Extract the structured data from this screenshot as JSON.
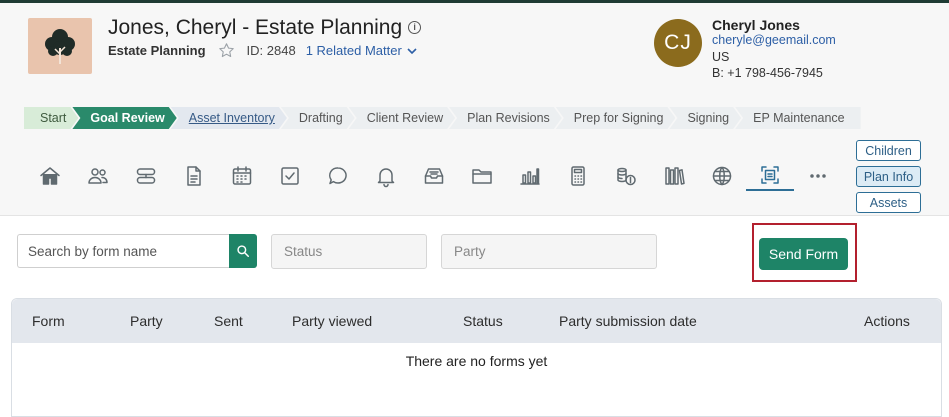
{
  "matter": {
    "title": "Jones, Cheryl - Estate Planning",
    "practice_area": "Estate Planning",
    "id_label": "ID: 2848",
    "related_matter": "1 Related Matter"
  },
  "client": {
    "initials": "CJ",
    "name": "Cheryl Jones",
    "email": "cheryle@geemail.com",
    "country": "US",
    "phone": "B: +1 798-456-7945",
    "avatar_color": "#8b6b1d"
  },
  "stages": [
    {
      "label": "Start",
      "state": "done"
    },
    {
      "label": "Goal Review",
      "state": "active"
    },
    {
      "label": "Asset Inventory",
      "state": "hover"
    },
    {
      "label": "Drafting",
      "state": "todo"
    },
    {
      "label": "Client Review",
      "state": "todo"
    },
    {
      "label": "Plan Revisions",
      "state": "todo"
    },
    {
      "label": "Prep for Signing",
      "state": "todo"
    },
    {
      "label": "Signing",
      "state": "todo"
    },
    {
      "label": "EP Maintenance",
      "state": "todo"
    }
  ],
  "toolbar_icons": [
    "home-icon",
    "people-icon",
    "layers-icon",
    "document-icon",
    "calendar-icon",
    "checkbox-icon",
    "chat-icon",
    "bell-icon",
    "inbox-icon",
    "folder-icon",
    "bar-chart-icon",
    "calculator-icon",
    "coins-icon",
    "library-icon",
    "globe-icon",
    "form-scan-icon",
    "more-icon"
  ],
  "active_tool": "form-scan-icon",
  "side_pills": {
    "children": "Children",
    "plan_info": "Plan Info",
    "assets": "Assets"
  },
  "filters": {
    "search_placeholder": "Search by form name",
    "status_placeholder": "Status",
    "party_placeholder": "Party"
  },
  "send_form_label": "Send Form",
  "table": {
    "columns": [
      "Form",
      "Party",
      "Sent",
      "Party viewed",
      "Status",
      "Party submission date",
      "Actions"
    ],
    "empty_message": "There are no forms yet"
  },
  "colors": {
    "accent": "#1e8467",
    "active_stage": "#2a8a6b",
    "highlight": "#b3202e",
    "link": "#2d5fa6"
  }
}
